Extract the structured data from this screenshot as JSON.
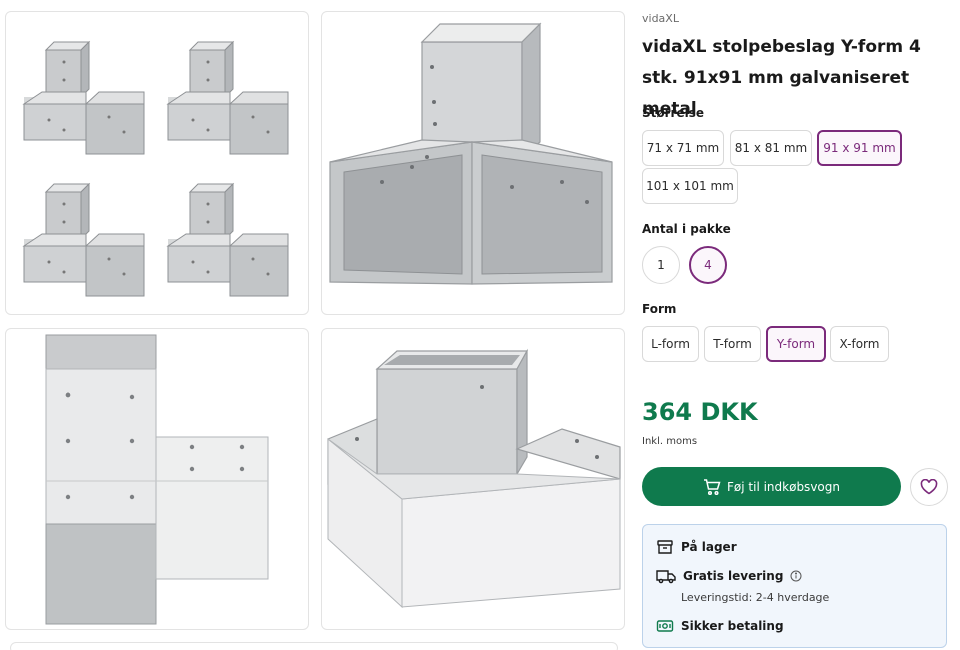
{
  "product": {
    "brand": "vidaXL",
    "title": "vidaXL stolpebeslag Y-form 4 stk. 91x91 mm galvaniseret metal"
  },
  "size": {
    "label": "Størrelse",
    "options": [
      "71 x 71 mm",
      "81 x 81 mm",
      "91 x 91 mm",
      "101 x 101 mm"
    ],
    "selected": "91 x 91 mm"
  },
  "quantity": {
    "label": "Antal i pakke",
    "options": [
      "1",
      "4"
    ],
    "selected": "4"
  },
  "form": {
    "label": "Form",
    "options": [
      "L-form",
      "T-form",
      "Y-form",
      "X-form"
    ],
    "selected": "Y-form"
  },
  "price": {
    "value": "364 DKK",
    "note": "Inkl. moms"
  },
  "actions": {
    "add_to_cart": "Føj til indkøbsvogn"
  },
  "info": {
    "stock": "På lager",
    "shipping": "Gratis levering",
    "delivery_time": "Leveringstid: 2-4 hverdage",
    "payment": "Sikker betaling"
  },
  "colors": {
    "accent_green": "#0f7a4d",
    "selected_purple": "#7b2a7b",
    "info_bg": "#f1f6fc"
  },
  "icons": [
    "cart-icon",
    "heart-icon",
    "box-icon",
    "truck-icon",
    "info-icon",
    "payment-icon"
  ]
}
